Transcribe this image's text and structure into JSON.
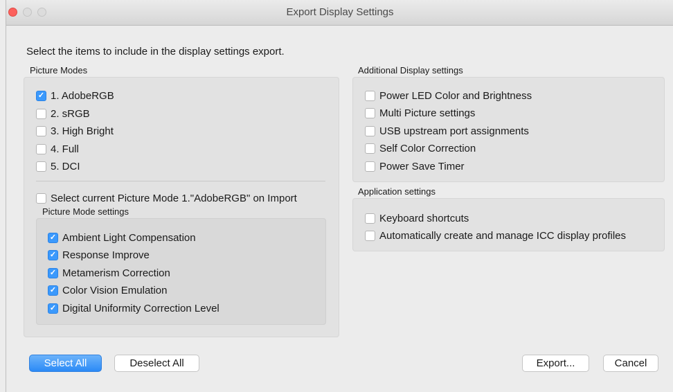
{
  "window": {
    "title": "Export Display Settings"
  },
  "instructions": "Select the items to include in the display settings export.",
  "picture_modes": {
    "heading": "Picture Modes",
    "items": [
      {
        "label": "1. AdobeRGB",
        "checked": true
      },
      {
        "label": "2. sRGB",
        "checked": false
      },
      {
        "label": "3. High Bright",
        "checked": false
      },
      {
        "label": "4. Full",
        "checked": false
      },
      {
        "label": "5. DCI",
        "checked": false
      }
    ],
    "select_current": {
      "label": "Select current Picture Mode 1.\"AdobeRGB\" on Import",
      "checked": false
    },
    "settings": {
      "heading": "Picture Mode settings",
      "items": [
        {
          "label": "Ambient Light Compensation",
          "checked": true
        },
        {
          "label": "Response Improve",
          "checked": true
        },
        {
          "label": "Metamerism Correction",
          "checked": true
        },
        {
          "label": "Color Vision Emulation",
          "checked": true
        },
        {
          "label": "Digital Uniformity Correction Level",
          "checked": true
        }
      ]
    }
  },
  "additional": {
    "heading": "Additional Display settings",
    "items": [
      {
        "label": "Power LED Color and Brightness",
        "checked": false
      },
      {
        "label": "Multi Picture settings",
        "checked": false
      },
      {
        "label": "USB upstream port assignments",
        "checked": false
      },
      {
        "label": "Self Color Correction",
        "checked": false
      },
      {
        "label": "Power Save Timer",
        "checked": false
      }
    ]
  },
  "application": {
    "heading": "Application settings",
    "items": [
      {
        "label": "Keyboard shortcuts",
        "checked": false
      },
      {
        "label": "Automatically create and manage ICC display profiles",
        "checked": false
      }
    ]
  },
  "buttons": {
    "select_all": "Select All",
    "deselect_all": "Deselect All",
    "export": "Export...",
    "cancel": "Cancel"
  },
  "colors": {
    "accent": "#3b99fc",
    "close_light": "#fc605c"
  }
}
